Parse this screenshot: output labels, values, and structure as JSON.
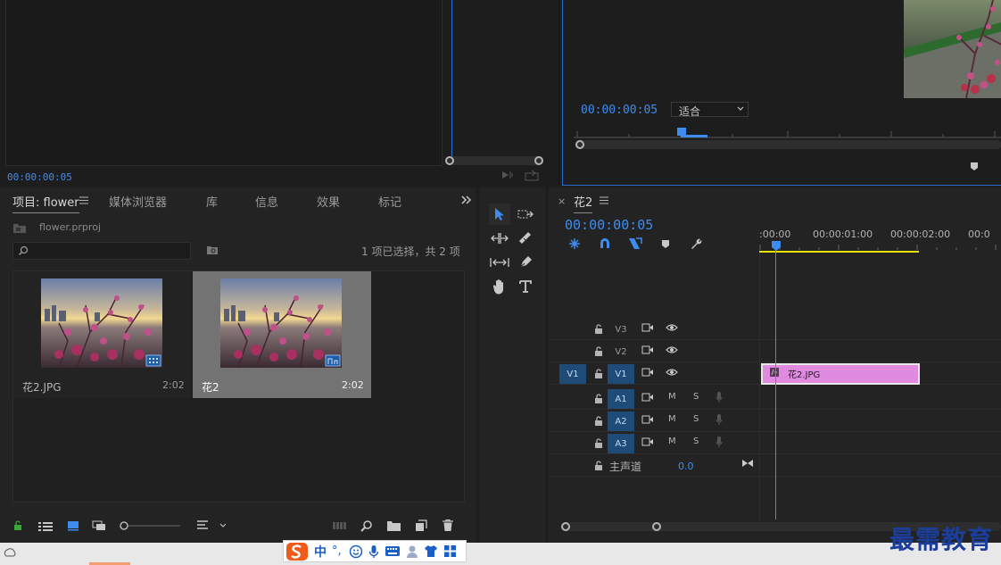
{
  "source_monitor": {
    "timecode": "00:00:00:05"
  },
  "program_monitor": {
    "timecode": "00:00:00:05",
    "zoom_select": "适合"
  },
  "project_panel": {
    "tabs": [
      "项目: flower",
      "媒体浏览器",
      "库",
      "信息",
      "效果",
      "标记"
    ],
    "menu_icon": "hamburger-icon",
    "expand_icon": "double-chevron-right-icon",
    "project_file": "flower.prproj",
    "search_placeholder": "",
    "selection_info": "1 项已选择，共 2 项",
    "items": [
      {
        "name": "花2.JPG",
        "duration": "2:02",
        "badge": "image-badge-icon",
        "selected": false
      },
      {
        "name": "花2",
        "duration": "2:02",
        "badge": "sequence-badge-icon",
        "selected": true
      }
    ]
  },
  "timeline": {
    "sequence_name": "花2",
    "timecode": "00:00:00:05",
    "ruler_labels": [
      ":00:00",
      "00:00:01:00",
      "00:00:02:00",
      "00:0"
    ],
    "video_tracks": [
      {
        "name": "V3",
        "active": false
      },
      {
        "name": "V2",
        "active": false
      },
      {
        "name": "V1",
        "active": true,
        "source": "V1"
      }
    ],
    "audio_tracks": [
      {
        "name": "A1",
        "mute": "M",
        "solo": "S"
      },
      {
        "name": "A2",
        "mute": "M",
        "solo": "S"
      },
      {
        "name": "A3",
        "mute": "M",
        "solo": "S"
      }
    ],
    "master": {
      "label": "主声道",
      "value": "0.0"
    },
    "clip": {
      "label": "花2.JPG",
      "color": "#e08ae0"
    },
    "work_area_color": "#e8e000",
    "playhead_color": "#3d8cf0"
  },
  "ime_toolbar": {
    "items": [
      "中",
      "°,"
    ]
  },
  "watermark": "最需教育"
}
